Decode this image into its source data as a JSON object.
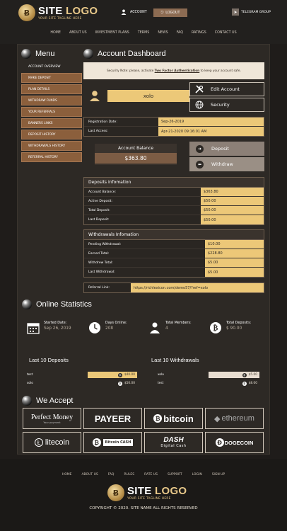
{
  "header": {
    "logo": {
      "word1": "SITE",
      "word2": "LOGO",
      "tagline": "YOUR SITE TAGLINE HERE"
    },
    "account_label": "ACCOUNT",
    "logout_label": "LOGOUT",
    "telegram_label": "TELEGRAM GROUP"
  },
  "nav": [
    "HOME",
    "ABOUT US",
    "INVESTMENT PLANS",
    "TERMS",
    "NEWS",
    "FAQ",
    "RATINGS",
    "CONTACT US"
  ],
  "sidebar": {
    "title": "Menu",
    "items": [
      "ACCOUNT OVERVIEW",
      "MAKE DEPOSIT",
      "PLAN DETAILS",
      "WITHDRAW FUNDS",
      "YOUR REFERRALS",
      "BANNERS LINKS",
      "DEPOSIT HISTORY",
      "WITHDRAWALS HISTORY",
      "REFERRAL HISTORY"
    ]
  },
  "dashboard": {
    "title": "Account Dashboard",
    "security_text": "Security Note: please, activate",
    "security_link": "Two Factor Authentication",
    "security_tail": "to keep your account safe.",
    "username": "xolo",
    "edit_account": "Edit Account",
    "security_button": "Security",
    "registration_label": "Registration Date:",
    "registration_value": "Sep-26-2019",
    "last_access_label": "Last Access:",
    "last_access_value": "Apr-21-2020 09:16:01 AM",
    "balance_label": "Account Balance",
    "balance_value": "$363.80",
    "deposit_button": "Deposit",
    "withdraw_button": "Withdraw",
    "deposits": {
      "title": "Deposits Infomation",
      "rows": [
        {
          "k": "Account Balance:",
          "v": "$363.80"
        },
        {
          "k": "Active Deposit:",
          "v": "$50.00"
        },
        {
          "k": "Total Deposit:",
          "v": "$50.00"
        },
        {
          "k": "Last Deposit:",
          "v": "$50.00"
        }
      ]
    },
    "withdrawals": {
      "title": "Withdrawals Infomation",
      "rows": [
        {
          "k": "Pending Withdrawal:",
          "v": "$10.00"
        },
        {
          "k": "Earned Total:",
          "v": "$228.80"
        },
        {
          "k": "Withdrew Total:",
          "v": "$5.00"
        },
        {
          "k": "Last Withdrawal:",
          "v": "$5.00"
        }
      ]
    },
    "referral_label": "Referral Link:",
    "referral_value": "https://richlexicon.com/demo57/?ref=xolo"
  },
  "stats": {
    "title": "Online Statistics",
    "items": [
      {
        "t": "Started Date:",
        "n": "Sep 26, 2019"
      },
      {
        "t": "Days Online:",
        "n": "208"
      },
      {
        "t": "Total Members:",
        "n": "4"
      },
      {
        "t": "Total Deposits:",
        "n": "$ 90.00"
      }
    ],
    "last_deposits_title": "Last 10 Deposits",
    "last_deposits": [
      {
        "name": "test",
        "amount": "$40.00"
      },
      {
        "name": "xolo",
        "amount": "$50.00"
      }
    ],
    "last_withdrawals_title": "Last 10 Withdrawals",
    "last_withdrawals": [
      {
        "name": "xolo",
        "amount": "$5.00"
      },
      {
        "name": "test",
        "amount": "$8.00"
      }
    ]
  },
  "accept": {
    "title": "We Accept",
    "methods": [
      "Perfect Money",
      "PAYEER",
      "bitcoin",
      "ethereum",
      "litecoin",
      "Bitcoin CASH",
      "DASH",
      "DOGECOIN"
    ],
    "perfect_money_sub": "Your payment",
    "dash_sub": "Digital Cash"
  },
  "footer": {
    "nav": [
      "HOME",
      "ABOUT US",
      "FAQ",
      "RULES",
      "RATE US",
      "SUPPORT",
      "LOGIN",
      "SIGN UP"
    ],
    "copyright": "COPYRIGHT © 2020. SITE NAME ALL RIGHTS RESERVED"
  },
  "colors": {
    "gold": "#ecc878",
    "brown": "#8b5f3c",
    "panel": "#2d2925"
  }
}
